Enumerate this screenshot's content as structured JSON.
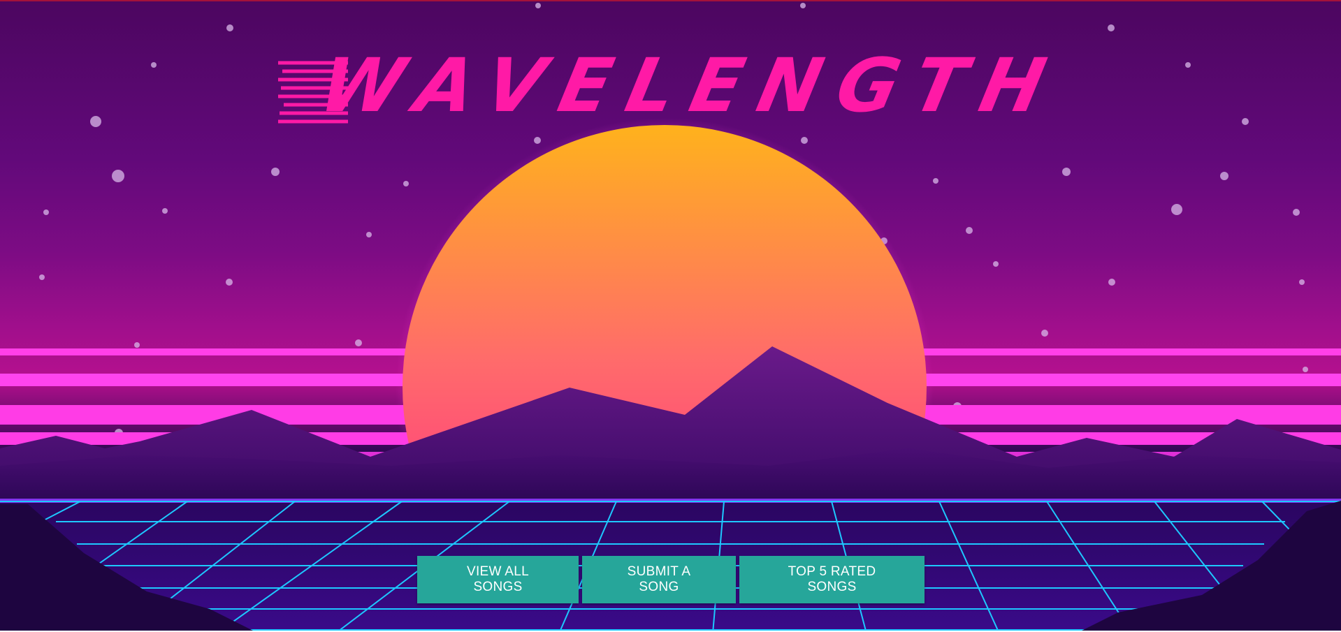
{
  "hero": {
    "title": "Wavelength"
  },
  "actions": {
    "view_all_label": "View All Songs",
    "submit_label": "Submit a Song",
    "top_rated_label": "Top 5 Rated Songs"
  },
  "colors": {
    "title": "#ff1aa6",
    "button": "#26a69a",
    "grid": "#1ec8ff",
    "sun_top": "#ffb21c",
    "sun_bottom": "#ff1a8c"
  }
}
